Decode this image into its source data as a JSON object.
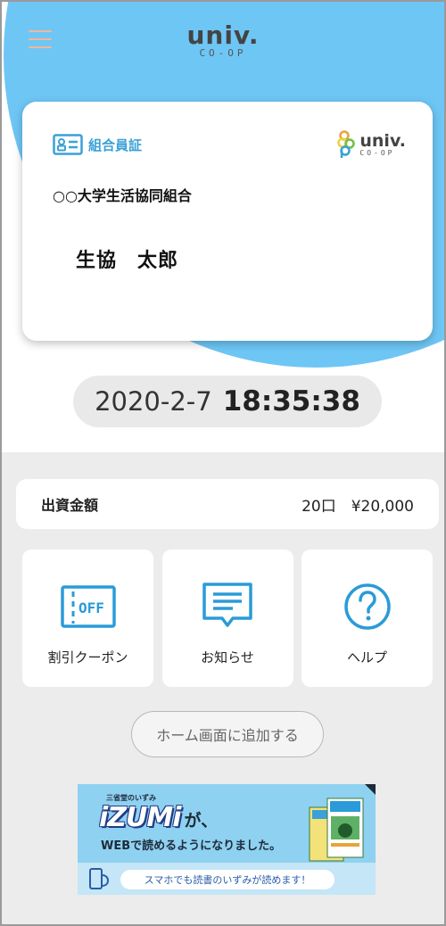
{
  "header": {
    "logo_univ": "univ.",
    "logo_coop": "CO-OP"
  },
  "card": {
    "label": "組合員証",
    "logo_univ": "univ.",
    "logo_coop": "CO-OP",
    "organization": "○○大学生活協同組合",
    "member_name": "生協　太郎"
  },
  "clock": {
    "date": "2020-2-7",
    "time": "18:35:38"
  },
  "investment": {
    "label": "出資金額",
    "value": "20口　¥20,000"
  },
  "tiles": [
    {
      "label": "割引クーポン",
      "icon": "coupon-off-icon",
      "icon_text": "OFF"
    },
    {
      "label": "お知らせ",
      "icon": "message-icon"
    },
    {
      "label": "ヘルプ",
      "icon": "help-icon"
    }
  ],
  "add_home_button": "ホーム画面に追加する",
  "banner": {
    "small_title": "三省堂のいずみ",
    "title": "iZUMi",
    "title_suffix": "が、",
    "subtitle": "WEBで読めるようになりました。",
    "pill_text": "スマホでも読書のいずみが読めます！"
  },
  "colors": {
    "accent_blue": "#6ec6f5",
    "label_blue": "#3ba1d6",
    "menu_orange": "#f1b69a"
  }
}
